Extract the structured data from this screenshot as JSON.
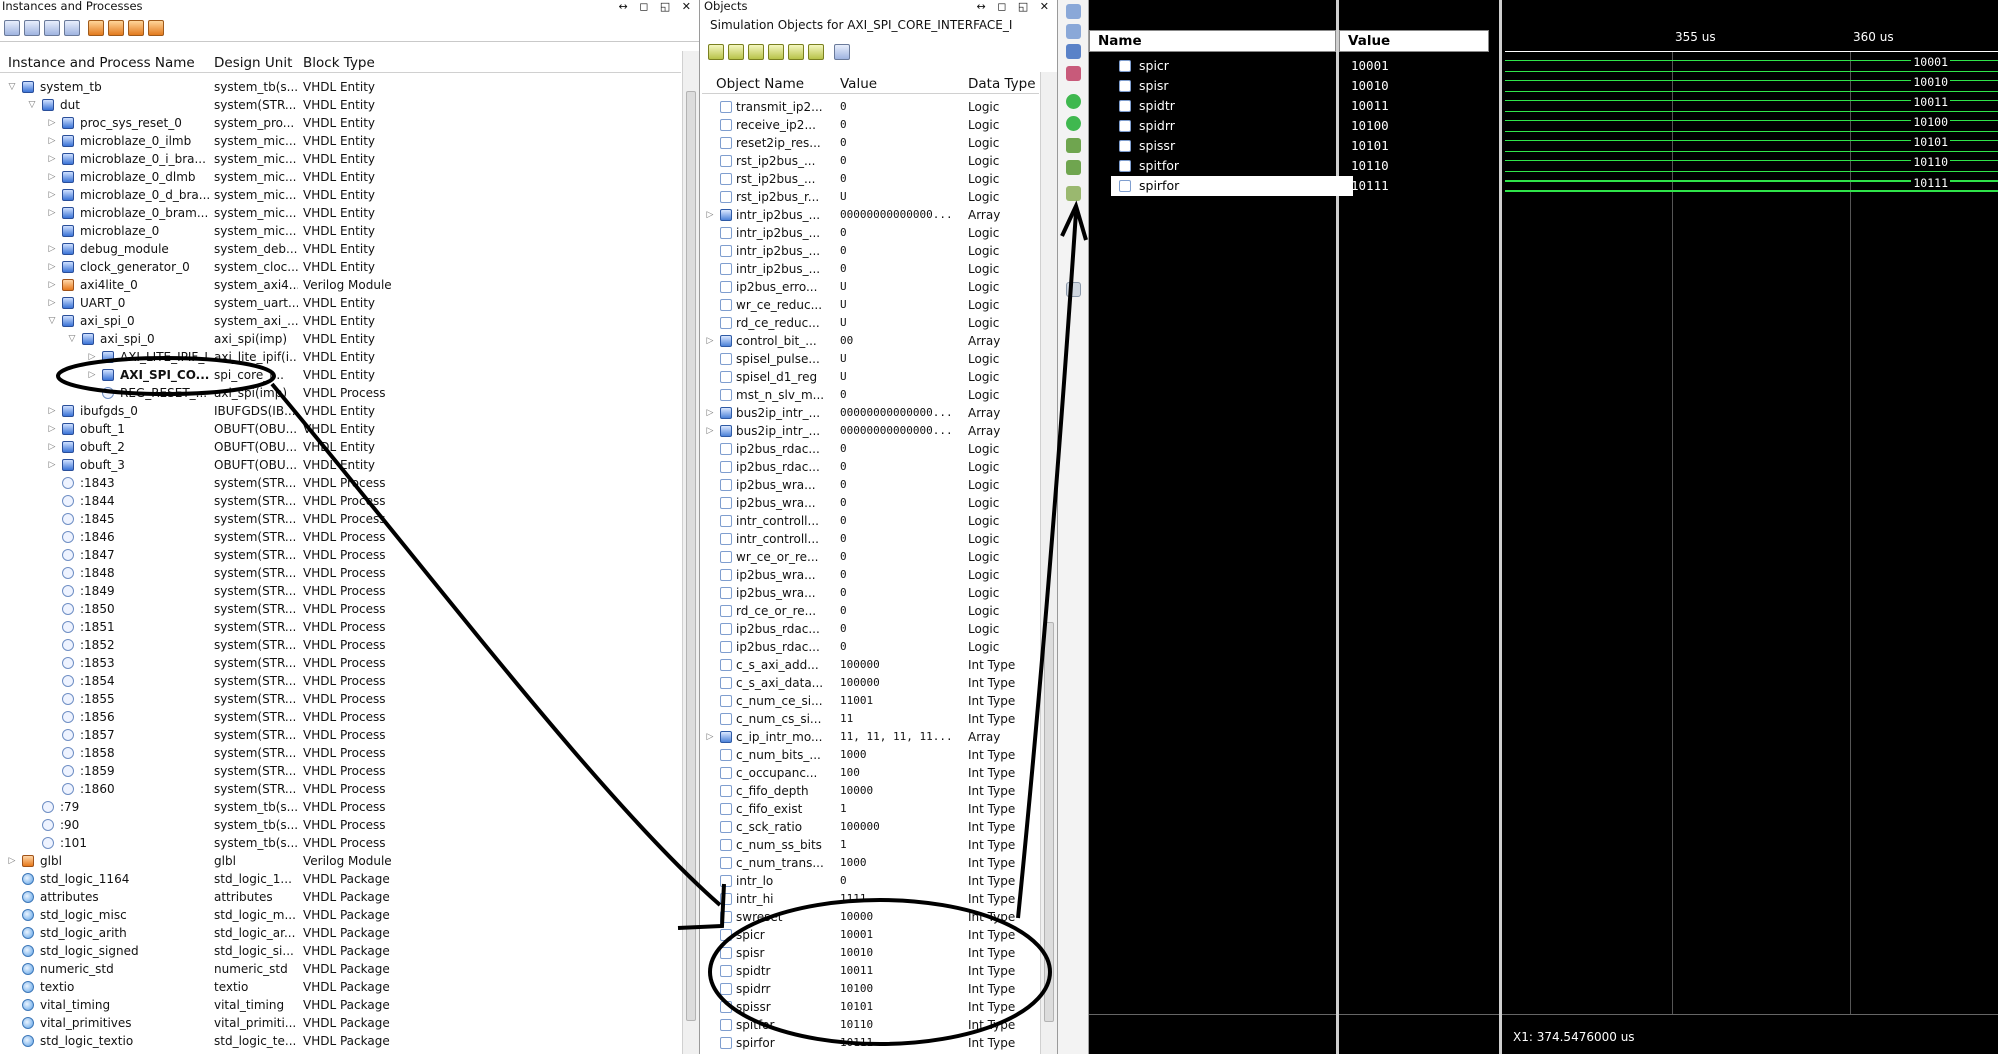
{
  "instances": {
    "title": "Instances and Processes",
    "columns": [
      "Instance and Process Name",
      "Design Unit",
      "Block Type"
    ],
    "rows": [
      {
        "level": 0,
        "exp": "open",
        "icon": "entity",
        "name": "system_tb",
        "unit": "system_tb(s...",
        "type": "VHDL Entity"
      },
      {
        "level": 1,
        "exp": "open",
        "icon": "entity",
        "name": "dut",
        "unit": "system(STR...",
        "type": "VHDL Entity"
      },
      {
        "level": 2,
        "exp": "closed",
        "icon": "entity",
        "name": "proc_sys_reset_0",
        "unit": "system_pro...",
        "type": "VHDL Entity"
      },
      {
        "level": 2,
        "exp": "closed",
        "icon": "entity",
        "name": "microblaze_0_ilmb",
        "unit": "system_mic...",
        "type": "VHDL Entity"
      },
      {
        "level": 2,
        "exp": "closed",
        "icon": "entity",
        "name": "microblaze_0_i_bra...",
        "unit": "system_mic...",
        "type": "VHDL Entity"
      },
      {
        "level": 2,
        "exp": "closed",
        "icon": "entity",
        "name": "microblaze_0_dlmb",
        "unit": "system_mic...",
        "type": "VHDL Entity"
      },
      {
        "level": 2,
        "exp": "closed",
        "icon": "entity",
        "name": "microblaze_0_d_bra...",
        "unit": "system_mic...",
        "type": "VHDL Entity"
      },
      {
        "level": 2,
        "exp": "closed",
        "icon": "entity",
        "name": "microblaze_0_bram...",
        "unit": "system_mic...",
        "type": "VHDL Entity"
      },
      {
        "level": 2,
        "exp": "",
        "icon": "entity",
        "name": "microblaze_0",
        "unit": "system_mic...",
        "type": "VHDL Entity"
      },
      {
        "level": 2,
        "exp": "closed",
        "icon": "entity",
        "name": "debug_module",
        "unit": "system_deb...",
        "type": "VHDL Entity"
      },
      {
        "level": 2,
        "exp": "closed",
        "icon": "entity",
        "name": "clock_generator_0",
        "unit": "system_cloc...",
        "type": "VHDL Entity"
      },
      {
        "level": 2,
        "exp": "closed",
        "icon": "verilog",
        "name": "axi4lite_0",
        "unit": "system_axi4...",
        "type": "Verilog Module"
      },
      {
        "level": 2,
        "exp": "closed",
        "icon": "entity",
        "name": "UART_0",
        "unit": "system_uart...",
        "type": "VHDL Entity"
      },
      {
        "level": 2,
        "exp": "open",
        "icon": "entity",
        "name": "axi_spi_0",
        "unit": "system_axi_...",
        "type": "VHDL Entity"
      },
      {
        "level": 3,
        "exp": "open",
        "icon": "entity",
        "name": "axi_spi_0",
        "unit": "axi_spi(imp)",
        "type": "VHDL Entity"
      },
      {
        "level": 4,
        "exp": "closed",
        "icon": "entity",
        "name": "AXI_LITE_IPIF_I",
        "unit": "axi_lite_ipif(i...",
        "type": "VHDL Entity"
      },
      {
        "level": 4,
        "exp": "closed",
        "icon": "entity",
        "name": "AXI_SPI_CO...",
        "unit": "spi_core_i...",
        "type": "VHDL Entity",
        "bold": true
      },
      {
        "level": 4,
        "exp": "",
        "icon": "process",
        "name": "REG_RESET_...",
        "unit": "axi_spi(imp)",
        "type": "VHDL Process"
      },
      {
        "level": 2,
        "exp": "closed",
        "icon": "entity",
        "name": "ibufgds_0",
        "unit": "IBUFGDS(IB...",
        "type": "VHDL Entity"
      },
      {
        "level": 2,
        "exp": "closed",
        "icon": "entity",
        "name": "obuft_1",
        "unit": "OBUFT(OBU...",
        "type": "VHDL Entity"
      },
      {
        "level": 2,
        "exp": "closed",
        "icon": "entity",
        "name": "obuft_2",
        "unit": "OBUFT(OBU...",
        "type": "VHDL Entity"
      },
      {
        "level": 2,
        "exp": "closed",
        "icon": "entity",
        "name": "obuft_3",
        "unit": "OBUFT(OBU...",
        "type": "VHDL Entity"
      },
      {
        "level": 2,
        "exp": "",
        "icon": "process",
        "name": ":1843",
        "unit": "system(STR...",
        "type": "VHDL Process"
      },
      {
        "level": 2,
        "exp": "",
        "icon": "process",
        "name": ":1844",
        "unit": "system(STR...",
        "type": "VHDL Process"
      },
      {
        "level": 2,
        "exp": "",
        "icon": "process",
        "name": ":1845",
        "unit": "system(STR...",
        "type": "VHDL Process"
      },
      {
        "level": 2,
        "exp": "",
        "icon": "process",
        "name": ":1846",
        "unit": "system(STR...",
        "type": "VHDL Process"
      },
      {
        "level": 2,
        "exp": "",
        "icon": "process",
        "name": ":1847",
        "unit": "system(STR...",
        "type": "VHDL Process"
      },
      {
        "level": 2,
        "exp": "",
        "icon": "process",
        "name": ":1848",
        "unit": "system(STR...",
        "type": "VHDL Process"
      },
      {
        "level": 2,
        "exp": "",
        "icon": "process",
        "name": ":1849",
        "unit": "system(STR...",
        "type": "VHDL Process"
      },
      {
        "level": 2,
        "exp": "",
        "icon": "process",
        "name": ":1850",
        "unit": "system(STR...",
        "type": "VHDL Process"
      },
      {
        "level": 2,
        "exp": "",
        "icon": "process",
        "name": ":1851",
        "unit": "system(STR...",
        "type": "VHDL Process"
      },
      {
        "level": 2,
        "exp": "",
        "icon": "process",
        "name": ":1852",
        "unit": "system(STR...",
        "type": "VHDL Process"
      },
      {
        "level": 2,
        "exp": "",
        "icon": "process",
        "name": ":1853",
        "unit": "system(STR...",
        "type": "VHDL Process"
      },
      {
        "level": 2,
        "exp": "",
        "icon": "process",
        "name": ":1854",
        "unit": "system(STR...",
        "type": "VHDL Process"
      },
      {
        "level": 2,
        "exp": "",
        "icon": "process",
        "name": ":1855",
        "unit": "system(STR...",
        "type": "VHDL Process"
      },
      {
        "level": 2,
        "exp": "",
        "icon": "process",
        "name": ":1856",
        "unit": "system(STR...",
        "type": "VHDL Process"
      },
      {
        "level": 2,
        "exp": "",
        "icon": "process",
        "name": ":1857",
        "unit": "system(STR...",
        "type": "VHDL Process"
      },
      {
        "level": 2,
        "exp": "",
        "icon": "process",
        "name": ":1858",
        "unit": "system(STR...",
        "type": "VHDL Process"
      },
      {
        "level": 2,
        "exp": "",
        "icon": "process",
        "name": ":1859",
        "unit": "system(STR...",
        "type": "VHDL Process"
      },
      {
        "level": 2,
        "exp": "",
        "icon": "process",
        "name": ":1860",
        "unit": "system(STR...",
        "type": "VHDL Process"
      },
      {
        "level": 1,
        "exp": "",
        "icon": "process",
        "name": ":79",
        "unit": "system_tb(s...",
        "type": "VHDL Process"
      },
      {
        "level": 1,
        "exp": "",
        "icon": "process",
        "name": ":90",
        "unit": "system_tb(s...",
        "type": "VHDL Process"
      },
      {
        "level": 1,
        "exp": "",
        "icon": "process",
        "name": ":101",
        "unit": "system_tb(s...",
        "type": "VHDL Process"
      },
      {
        "level": 0,
        "exp": "closed",
        "icon": "verilog",
        "name": "glbl",
        "unit": "glbl",
        "type": "Verilog Module"
      },
      {
        "level": 0,
        "exp": "",
        "icon": "pkg",
        "name": "std_logic_1164",
        "unit": "std_logic_1...",
        "type": "VHDL Package"
      },
      {
        "level": 0,
        "exp": "",
        "icon": "pkg",
        "name": "attributes",
        "unit": "attributes",
        "type": "VHDL Package"
      },
      {
        "level": 0,
        "exp": "",
        "icon": "pkg",
        "name": "std_logic_misc",
        "unit": "std_logic_m...",
        "type": "VHDL Package"
      },
      {
        "level": 0,
        "exp": "",
        "icon": "pkg",
        "name": "std_logic_arith",
        "unit": "std_logic_ar...",
        "type": "VHDL Package"
      },
      {
        "level": 0,
        "exp": "",
        "icon": "pkg",
        "name": "std_logic_signed",
        "unit": "std_logic_si...",
        "type": "VHDL Package"
      },
      {
        "level": 0,
        "exp": "",
        "icon": "pkg",
        "name": "numeric_std",
        "unit": "numeric_std",
        "type": "VHDL Package"
      },
      {
        "level": 0,
        "exp": "",
        "icon": "pkg",
        "name": "textio",
        "unit": "textio",
        "type": "VHDL Package"
      },
      {
        "level": 0,
        "exp": "",
        "icon": "pkg",
        "name": "vital_timing",
        "unit": "vital_timing",
        "type": "VHDL Package"
      },
      {
        "level": 0,
        "exp": "",
        "icon": "pkg",
        "name": "vital_primitives",
        "unit": "vital_primiti...",
        "type": "VHDL Package"
      },
      {
        "level": 0,
        "exp": "",
        "icon": "pkg",
        "name": "std_logic_textio",
        "unit": "std_logic_te...",
        "type": "VHDL Package"
      }
    ]
  },
  "objects": {
    "title": "Objects",
    "subtitle": "Simulation Objects for AXI_SPI_CORE_INTERFACE_I",
    "columns": [
      "Object Name",
      "Value",
      "Data Type"
    ],
    "rows": [
      {
        "exp": "",
        "icon": "logic",
        "name": "transmit_ip2...",
        "value": "0",
        "type": "Logic"
      },
      {
        "exp": "",
        "icon": "logic",
        "name": "receive_ip2...",
        "value": "0",
        "type": "Logic"
      },
      {
        "exp": "",
        "icon": "logic",
        "name": "reset2ip_res...",
        "value": "0",
        "type": "Logic"
      },
      {
        "exp": "",
        "icon": "logic",
        "name": "rst_ip2bus_...",
        "value": "0",
        "type": "Logic"
      },
      {
        "exp": "",
        "icon": "logic",
        "name": "rst_ip2bus_...",
        "value": "0",
        "type": "Logic"
      },
      {
        "exp": "",
        "icon": "logic",
        "name": "rst_ip2bus_r...",
        "value": "U",
        "type": "Logic"
      },
      {
        "exp": "closed",
        "icon": "arr",
        "name": "intr_ip2bus_...",
        "value": "00000000000000...",
        "type": "Array"
      },
      {
        "exp": "",
        "icon": "logic",
        "name": "intr_ip2bus_...",
        "value": "0",
        "type": "Logic"
      },
      {
        "exp": "",
        "icon": "logic",
        "name": "intr_ip2bus_...",
        "value": "0",
        "type": "Logic"
      },
      {
        "exp": "",
        "icon": "logic",
        "name": "intr_ip2bus_...",
        "value": "0",
        "type": "Logic"
      },
      {
        "exp": "",
        "icon": "logic",
        "name": "ip2bus_erro...",
        "value": "U",
        "type": "Logic"
      },
      {
        "exp": "",
        "icon": "logic",
        "name": "wr_ce_reduc...",
        "value": "U",
        "type": "Logic"
      },
      {
        "exp": "",
        "icon": "logic",
        "name": "rd_ce_reduc...",
        "value": "U",
        "type": "Logic"
      },
      {
        "exp": "closed",
        "icon": "arr",
        "name": "control_bit_...",
        "value": "00",
        "type": "Array"
      },
      {
        "exp": "",
        "icon": "logic",
        "name": "spisel_pulse...",
        "value": "U",
        "type": "Logic"
      },
      {
        "exp": "",
        "icon": "logic",
        "name": "spisel_d1_reg",
        "value": "U",
        "type": "Logic"
      },
      {
        "exp": "",
        "icon": "logic",
        "name": "mst_n_slv_m...",
        "value": "0",
        "type": "Logic"
      },
      {
        "exp": "closed",
        "icon": "arr",
        "name": "bus2ip_intr_...",
        "value": "00000000000000...",
        "type": "Array"
      },
      {
        "exp": "closed",
        "icon": "arr",
        "name": "bus2ip_intr_...",
        "value": "00000000000000...",
        "type": "Array"
      },
      {
        "exp": "",
        "icon": "logic",
        "name": "ip2bus_rdac...",
        "value": "0",
        "type": "Logic"
      },
      {
        "exp": "",
        "icon": "logic",
        "name": "ip2bus_rdac...",
        "value": "0",
        "type": "Logic"
      },
      {
        "exp": "",
        "icon": "logic",
        "name": "ip2bus_wra...",
        "value": "0",
        "type": "Logic"
      },
      {
        "exp": "",
        "icon": "logic",
        "name": "ip2bus_wra...",
        "value": "0",
        "type": "Logic"
      },
      {
        "exp": "",
        "icon": "logic",
        "name": "intr_controll...",
        "value": "0",
        "type": "Logic"
      },
      {
        "exp": "",
        "icon": "logic",
        "name": "intr_controll...",
        "value": "0",
        "type": "Logic"
      },
      {
        "exp": "",
        "icon": "logic",
        "name": "wr_ce_or_re...",
        "value": "0",
        "type": "Logic"
      },
      {
        "exp": "",
        "icon": "logic",
        "name": "ip2bus_wra...",
        "value": "0",
        "type": "Logic"
      },
      {
        "exp": "",
        "icon": "logic",
        "name": "ip2bus_wra...",
        "value": "0",
        "type": "Logic"
      },
      {
        "exp": "",
        "icon": "logic",
        "name": "rd_ce_or_re...",
        "value": "0",
        "type": "Logic"
      },
      {
        "exp": "",
        "icon": "logic",
        "name": "ip2bus_rdac...",
        "value": "0",
        "type": "Logic"
      },
      {
        "exp": "",
        "icon": "logic",
        "name": "ip2bus_rdac...",
        "value": "0",
        "type": "Logic"
      },
      {
        "exp": "",
        "icon": "logic",
        "name": "c_s_axi_add...",
        "value": "100000",
        "type": "Int Type"
      },
      {
        "exp": "",
        "icon": "logic",
        "name": "c_s_axi_data...",
        "value": "100000",
        "type": "Int Type"
      },
      {
        "exp": "",
        "icon": "logic",
        "name": "c_num_ce_si...",
        "value": "11001",
        "type": "Int Type"
      },
      {
        "exp": "",
        "icon": "logic",
        "name": "c_num_cs_si...",
        "value": "11",
        "type": "Int Type"
      },
      {
        "exp": "closed",
        "icon": "arr",
        "name": "c_ip_intr_mo...",
        "value": "11, 11, 11, 11...",
        "type": "Array"
      },
      {
        "exp": "",
        "icon": "logic",
        "name": "c_num_bits_...",
        "value": "1000",
        "type": "Int Type"
      },
      {
        "exp": "",
        "icon": "logic",
        "name": "c_occupanc...",
        "value": "100",
        "type": "Int Type"
      },
      {
        "exp": "",
        "icon": "logic",
        "name": "c_fifo_depth",
        "value": "10000",
        "type": "Int Type"
      },
      {
        "exp": "",
        "icon": "logic",
        "name": "c_fifo_exist",
        "value": "1",
        "type": "Int Type"
      },
      {
        "exp": "",
        "icon": "logic",
        "name": "c_sck_ratio",
        "value": "100000",
        "type": "Int Type"
      },
      {
        "exp": "",
        "icon": "logic",
        "name": "c_num_ss_bits",
        "value": "1",
        "type": "Int Type"
      },
      {
        "exp": "",
        "icon": "logic",
        "name": "c_num_trans...",
        "value": "1000",
        "type": "Int Type"
      },
      {
        "exp": "",
        "icon": "logic",
        "name": "intr_lo",
        "value": "0",
        "type": "Int Type"
      },
      {
        "exp": "",
        "icon": "logic",
        "name": "intr_hi",
        "value": "1111",
        "type": "Int Type"
      },
      {
        "exp": "",
        "icon": "logic",
        "name": "swreset",
        "value": "10000",
        "type": "Int Type"
      },
      {
        "exp": "",
        "icon": "logic",
        "name": "spicr",
        "value": "10001",
        "type": "Int Type"
      },
      {
        "exp": "",
        "icon": "logic",
        "name": "spisr",
        "value": "10010",
        "type": "Int Type"
      },
      {
        "exp": "",
        "icon": "logic",
        "name": "spidtr",
        "value": "10011",
        "type": "Int Type"
      },
      {
        "exp": "",
        "icon": "logic",
        "name": "spidrr",
        "value": "10100",
        "type": "Int Type"
      },
      {
        "exp": "",
        "icon": "logic",
        "name": "spissr",
        "value": "10101",
        "type": "Int Type"
      },
      {
        "exp": "",
        "icon": "logic",
        "name": "spitfor",
        "value": "10110",
        "type": "Int Type"
      },
      {
        "exp": "",
        "icon": "logic",
        "name": "spirfor",
        "value": "10111",
        "type": "Int Type"
      }
    ]
  },
  "wave": {
    "name_header": "Name",
    "value_header": "Value",
    "signals": [
      {
        "name": "spicr",
        "value": "10001"
      },
      {
        "name": "spisr",
        "value": "10010"
      },
      {
        "name": "spidtr",
        "value": "10011"
      },
      {
        "name": "spidrr",
        "value": "10100"
      },
      {
        "name": "spissr",
        "value": "10101"
      },
      {
        "name": "spitfor",
        "value": "10110"
      },
      {
        "name": "spirfor",
        "value": "10111"
      }
    ],
    "selected_signal": "spirfor",
    "ticks": [
      "355 us",
      "360 us"
    ],
    "cursor_readout": "X1: 374.5476000 us",
    "trace_color": "#2fe34a"
  },
  "ui_glyphs": {
    "pane_controls": "↔ ◻ ◱ ✕"
  }
}
